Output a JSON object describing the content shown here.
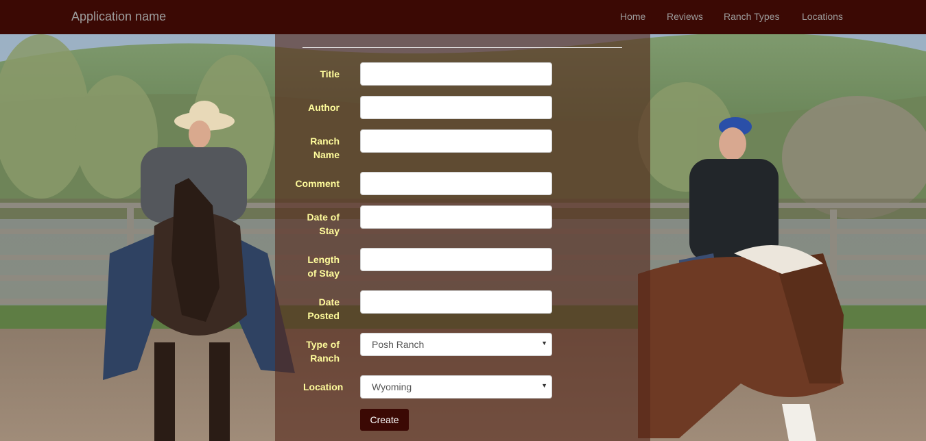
{
  "navbar": {
    "brand": "Application name",
    "links": [
      "Home",
      "Reviews",
      "Ranch Types",
      "Locations"
    ]
  },
  "form": {
    "fields": [
      {
        "label_lines": [
          "Title"
        ]
      },
      {
        "label_lines": [
          "Author"
        ]
      },
      {
        "label_lines": [
          "Ranch",
          "Name"
        ]
      },
      {
        "label_lines": [
          "Comment"
        ]
      },
      {
        "label_lines": [
          "Date of",
          "Stay"
        ]
      },
      {
        "label_lines": [
          "Length",
          "of Stay"
        ]
      },
      {
        "label_lines": [
          "Date",
          "Posted"
        ]
      }
    ],
    "type_of_ranch": {
      "label_lines": [
        "Type of",
        "Ranch"
      ],
      "value": "Posh Ranch"
    },
    "location": {
      "label": "Location",
      "value": "Wyoming"
    },
    "submit_label": "Create"
  },
  "colors": {
    "navbar_bg": "#3b0904",
    "label_text": "#fffc9c",
    "button_bg": "#3b0904"
  },
  "icons": {
    "select_caret": "caret-down-icon"
  }
}
